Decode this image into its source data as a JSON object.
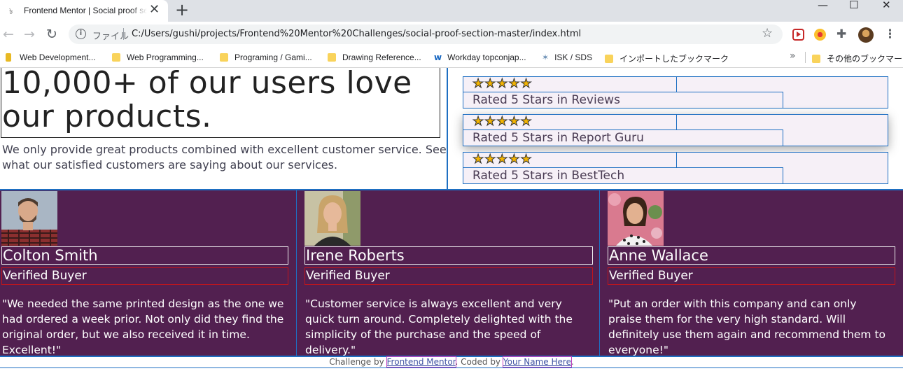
{
  "browser": {
    "tab": {
      "title": "Frontend Mentor | Social proof section"
    },
    "window_controls": {
      "minimize": "—",
      "maximize": "☐",
      "close": "✕"
    },
    "omnibox": {
      "label": "ファイル",
      "url": "C:/Users/gushi/projects/Frontend%20Mentor%20Challenges/social-proof-section-master/index.html"
    },
    "bookmarks": [
      {
        "label": "Web Development...",
        "icon": "page-icon"
      },
      {
        "label": "Web Programming...",
        "icon": "folder-icon"
      },
      {
        "label": "Programing / Gami...",
        "icon": "folder-icon"
      },
      {
        "label": "Drawing Reference...",
        "icon": "folder-icon"
      },
      {
        "label": "Workday topconjap...",
        "icon": "workday-icon"
      },
      {
        "label": "ISK / SDS",
        "icon": "isk-icon"
      },
      {
        "label": "インポートしたブックマーク",
        "icon": "folder-icon"
      },
      {
        "label": "その他のブックマーク",
        "icon": "folder-icon"
      }
    ],
    "accent_color": "#dee1e6"
  },
  "page": {
    "headline": "10,000+ of our users love our products.",
    "intro": "We only provide great products combined with excellent customer service. See what our satisfied customers are saying about our services.",
    "ratings": [
      {
        "stars": "★★★★★",
        "label": "Rated 5 Stars in Reviews"
      },
      {
        "stars": "★★★★★",
        "label": "Rated 5 Stars in Report Guru"
      },
      {
        "stars": "★★★★★",
        "label": "Rated 5 Stars in BestTech"
      }
    ],
    "testimonials": [
      {
        "name": "Colton Smith",
        "role": "Verified Buyer",
        "quote": "\"We needed the same printed design as the one we had ordered a week prior. Not only did they find the original order, but we also received it in time. Excellent!\""
      },
      {
        "name": "Irene Roberts",
        "role": "Verified Buyer",
        "quote": "\"Customer service is always excellent and very quick turn around. Completely delighted with the simplicity of the purchase and the speed of delivery.\""
      },
      {
        "name": "Anne Wallace",
        "role": "Verified Buyer",
        "quote": "\"Put an order with this company and can only praise them for the very high standard. Will definitely use them again and recommend them to everyone!\""
      }
    ],
    "footer": {
      "prefix": "Challenge by ",
      "link1": "Frontend Mentor",
      "middle": ". Coded by ",
      "link2": "Your Name Here",
      "suffix": "."
    },
    "colors": {
      "testimonial_bg": "#522050",
      "outline": "#1e6fc2",
      "star": "#f5b500"
    }
  }
}
